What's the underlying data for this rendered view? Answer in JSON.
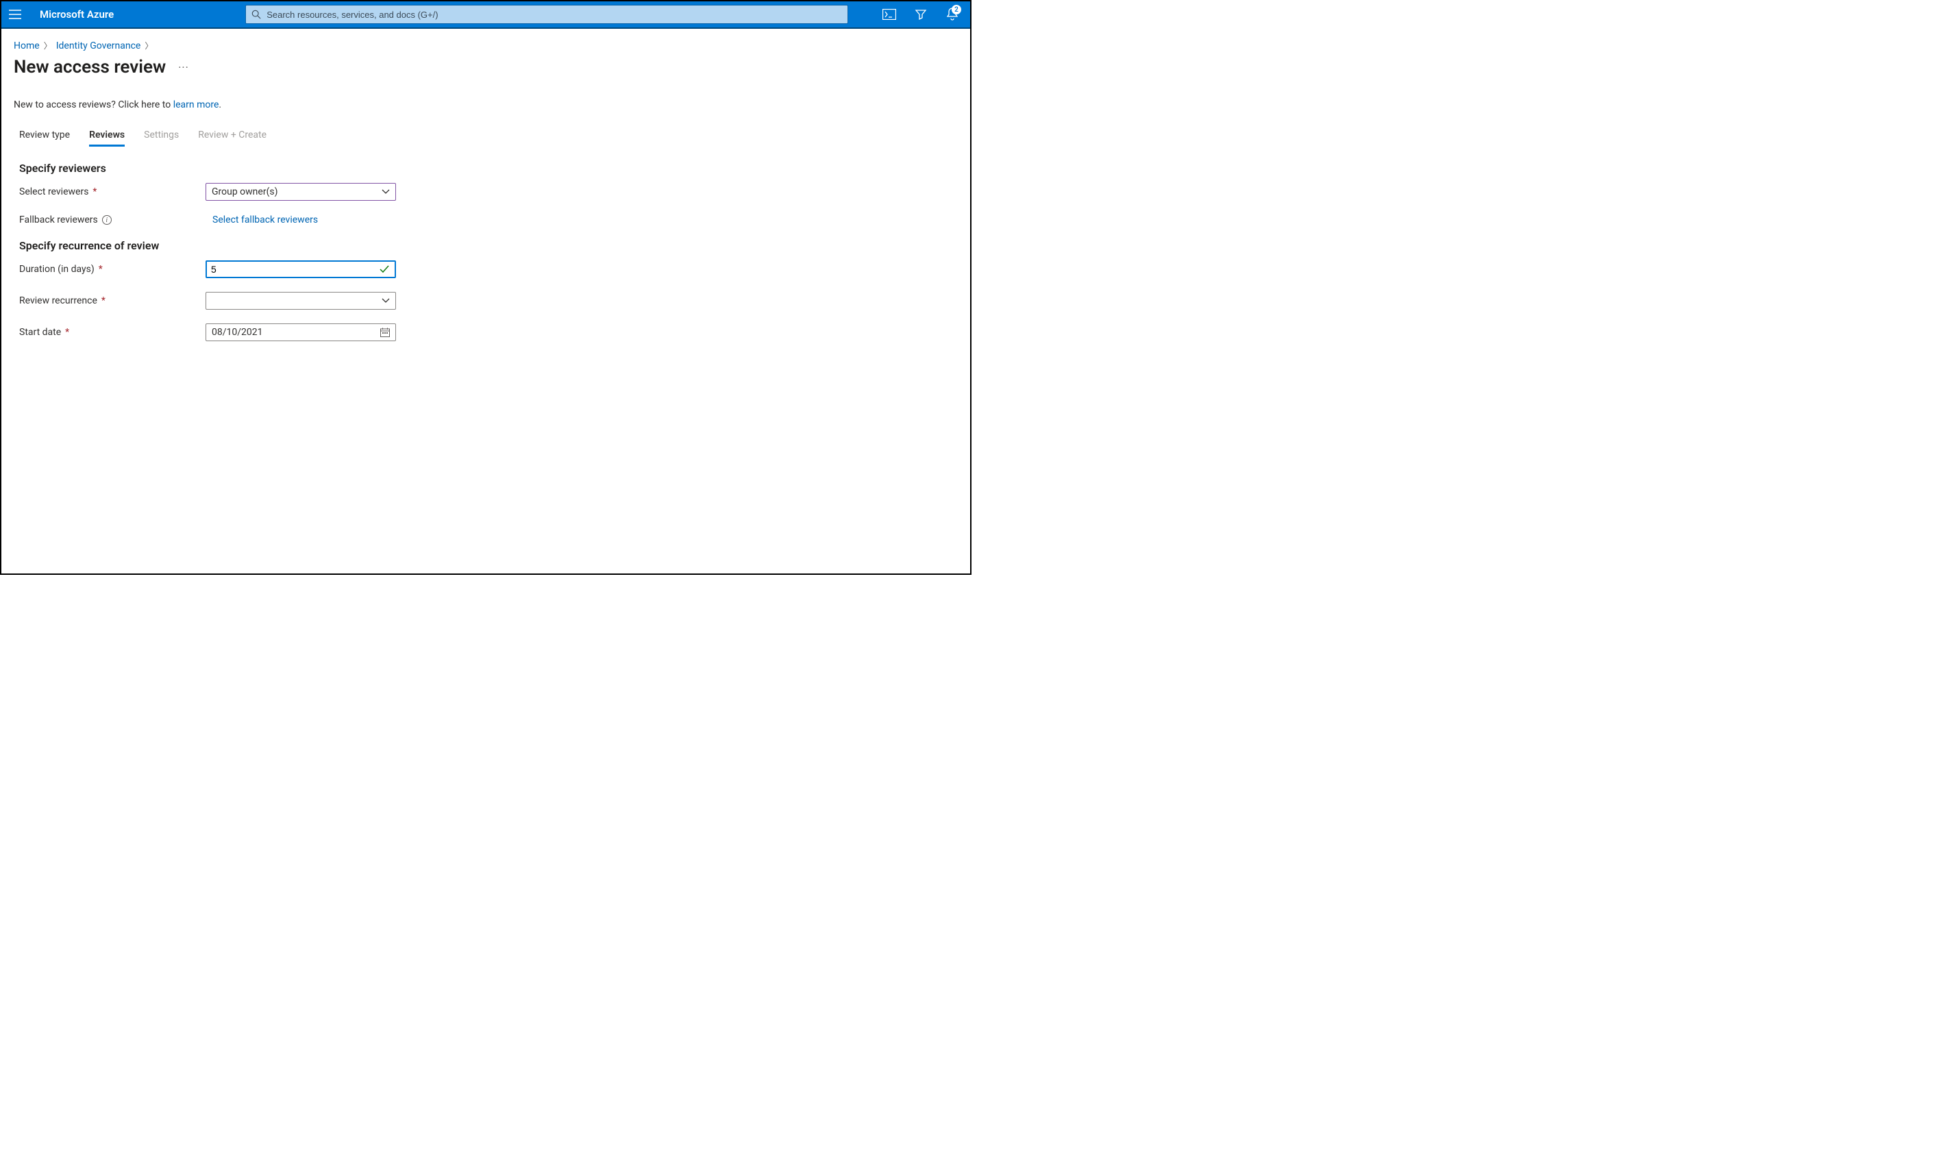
{
  "header": {
    "brand": "Microsoft Azure",
    "search_placeholder": "Search resources, services, and docs (G+/)",
    "notification_count": "2"
  },
  "breadcrumb": {
    "home": "Home",
    "identity_governance": "Identity Governance"
  },
  "page": {
    "title": "New access review",
    "intro_prefix": "New to access reviews? Click here to ",
    "intro_link": "learn more",
    "intro_suffix": "."
  },
  "tabs": {
    "review_type": "Review type",
    "reviews": "Reviews",
    "settings": "Settings",
    "review_create": "Review + Create"
  },
  "section1": {
    "heading": "Specify reviewers",
    "select_reviewers_label": "Select reviewers",
    "select_reviewers_value": "Group owner(s)",
    "fallback_label": "Fallback reviewers",
    "fallback_link": "Select fallback reviewers"
  },
  "section2": {
    "heading": "Specify recurrence of review",
    "duration_label": "Duration (in days)",
    "duration_value": "5",
    "recurrence_label": "Review recurrence",
    "recurrence_value": "",
    "start_date_label": "Start date",
    "start_date_value": "08/10/2021"
  }
}
